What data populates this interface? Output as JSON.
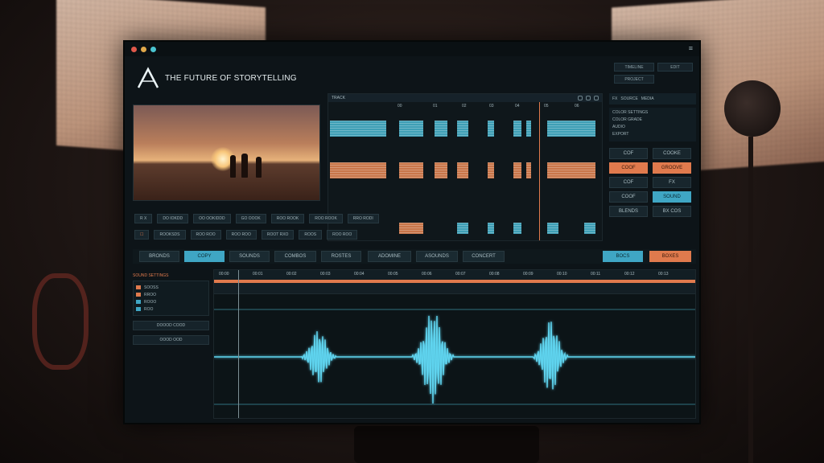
{
  "app": {
    "title": "THE FUTURE OF STORYTELLING",
    "window_menu": "≡"
  },
  "top_right": [
    "TIMELINE",
    "EDIT",
    "PROJECT",
    ""
  ],
  "tracks": {
    "toolbar_label": "TRACK",
    "ticks": [
      "00",
      "01",
      "02",
      "03",
      "04",
      "05",
      "06"
    ]
  },
  "right_panel": {
    "tabs": [
      "FX",
      "SOURCE",
      "MEDIA"
    ],
    "list": [
      "COLOR SETTINGS",
      "COLOR GRADE",
      "AUDIO",
      "EXPORT"
    ],
    "buttons": [
      {
        "label": "COF",
        "style": "dark"
      },
      {
        "label": "COOKE",
        "style": "dark"
      },
      {
        "label": "COOF",
        "style": "orange"
      },
      {
        "label": "GROOVE",
        "style": "orange"
      },
      {
        "label": "COF",
        "style": "dark"
      },
      {
        "label": "FX",
        "style": "dark"
      },
      {
        "label": "COOF",
        "style": "dark"
      },
      {
        "label": "SOUND",
        "style": "cyan"
      },
      {
        "label": "BLENDS",
        "style": "dark"
      },
      {
        "label": "BX COS",
        "style": "dark"
      }
    ]
  },
  "row1": [
    "R X",
    "DO IOKDD",
    "OO OOKIDDD",
    "GO OOOK",
    "ROO ROOK",
    "ROO ROOK",
    "RRO RODI"
  ],
  "row2": [
    "☐",
    "ROOKSDS",
    "ROO ROO",
    "ROO ROO",
    "ROOT RXO",
    "ROOS",
    "ROO ROO"
  ],
  "toolbar": [
    {
      "label": "BRONDS",
      "style": "dark"
    },
    {
      "label": "COPY",
      "style": "cyan"
    },
    {
      "label": "SOUNDS",
      "style": "dark"
    },
    {
      "label": "COMBOS",
      "style": "dark"
    },
    {
      "label": "ROSTES",
      "style": "dark"
    },
    {
      "label": "ADOMINE",
      "style": "dark"
    },
    {
      "label": "ASOUNDS",
      "style": "dark"
    },
    {
      "label": "CONCERT",
      "style": "dark"
    },
    {
      "label": "BOCS",
      "style": "cyan"
    },
    {
      "label": "BOXES",
      "style": "orange"
    }
  ],
  "lower_left": {
    "header": "SOUND SETTINGS",
    "rows": [
      "SOOSS",
      "RROO",
      "ROOO",
      "ROO"
    ],
    "buttons": [
      "DOOOD COOD",
      "OOOD OOD"
    ]
  },
  "ruler_ticks": [
    "00:00",
    "00:01",
    "00:02",
    "00:03",
    "00:04",
    "00:05",
    "00:06",
    "00:07",
    "00:08",
    "00:09",
    "00:10",
    "00:11",
    "00:12",
    "00:13"
  ],
  "colors": {
    "accent_orange": "#e07a4d",
    "accent_cyan": "#3fa6c4",
    "waveform": "#5fd4ef"
  }
}
